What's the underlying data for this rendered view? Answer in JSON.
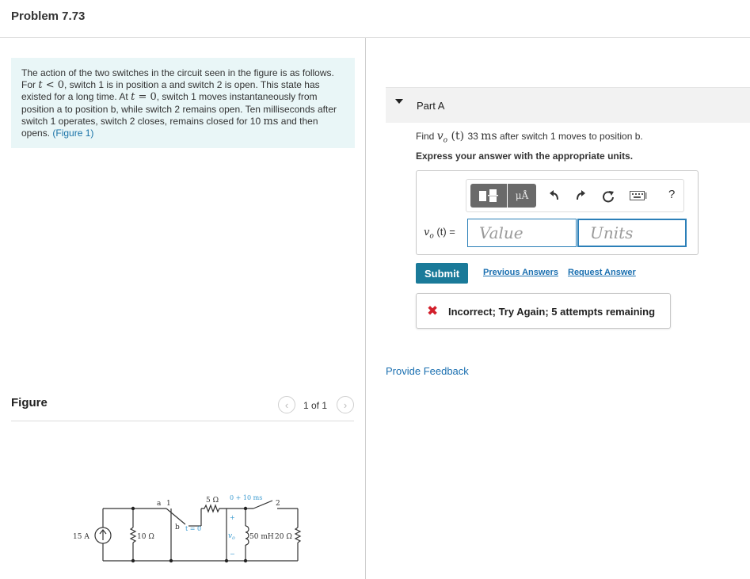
{
  "page": {
    "title": "Problem 7.73"
  },
  "problem": {
    "t1": "The action of the two switches in the circuit seen in the figure is as follows. For ",
    "m_t": "t",
    "m_lt0": " < 0",
    "t2": ", switch 1 is in position a and switch 2 is open. This state has existed for a long time. At ",
    "m_eq0": " = 0",
    "t3": ", switch 1 moves instantaneously from position a to position b, while switch 2 remains open. Ten milliseconds after switch 1 operates, switch 2 closes, remains closed for 10 ",
    "m_ms": "ms",
    "t4": " and then opens. ",
    "figure_link": "(Figure 1)"
  },
  "figure": {
    "label": "Figure",
    "pager": "1 of 1",
    "prev_icon": "chevron-left-icon",
    "next_icon": "chevron-right-icon",
    "circuit": {
      "src": "15 A",
      "r10": "10 Ω",
      "r5": "5 Ω",
      "r20": "20 Ω",
      "l": "50 mH",
      "a": "a",
      "b": "b",
      "one": "1",
      "two": "2",
      "t0": "t = 0",
      "t10": "0 + 10 ms",
      "vo": "v",
      "vo_sub": "o",
      "plus": "+",
      "minus": "−"
    }
  },
  "part": {
    "title": "Part A",
    "q_find": "Find ",
    "q_v": "v",
    "q_sub": "o",
    "q_t": " (t) ",
    "q_val": " 33 ",
    "q_unit": "ms",
    "q_rest": " after switch 1 moves to position b.",
    "instruction": "Express your answer with the appropriate units.",
    "var_v": "v",
    "var_sub": "o",
    "var_rest": " (t) =",
    "value_placeholder": "Value",
    "units_placeholder": "Units",
    "toolbar": {
      "templates_icon": "templates-icon",
      "units_label": "μÅ",
      "undo_icon": "undo-icon",
      "redo_icon": "redo-icon",
      "reset_icon": "reset-icon",
      "keyboard_icon": "keyboard-icon",
      "help_label": "?"
    },
    "submit": "Submit",
    "previous_answers": "Previous Answers",
    "request_answer": "Request Answer",
    "feedback": "Incorrect; Try Again; 5 attempts remaining",
    "feedback_icon": "x-icon",
    "feedback_color": "#d21f2b"
  },
  "provide_feedback": "Provide Feedback",
  "colors": {
    "accent": "#1a7a99",
    "link": "#1a6fb0",
    "problem_bg": "#e9f6f7",
    "input_border": "#2b7fb8"
  }
}
